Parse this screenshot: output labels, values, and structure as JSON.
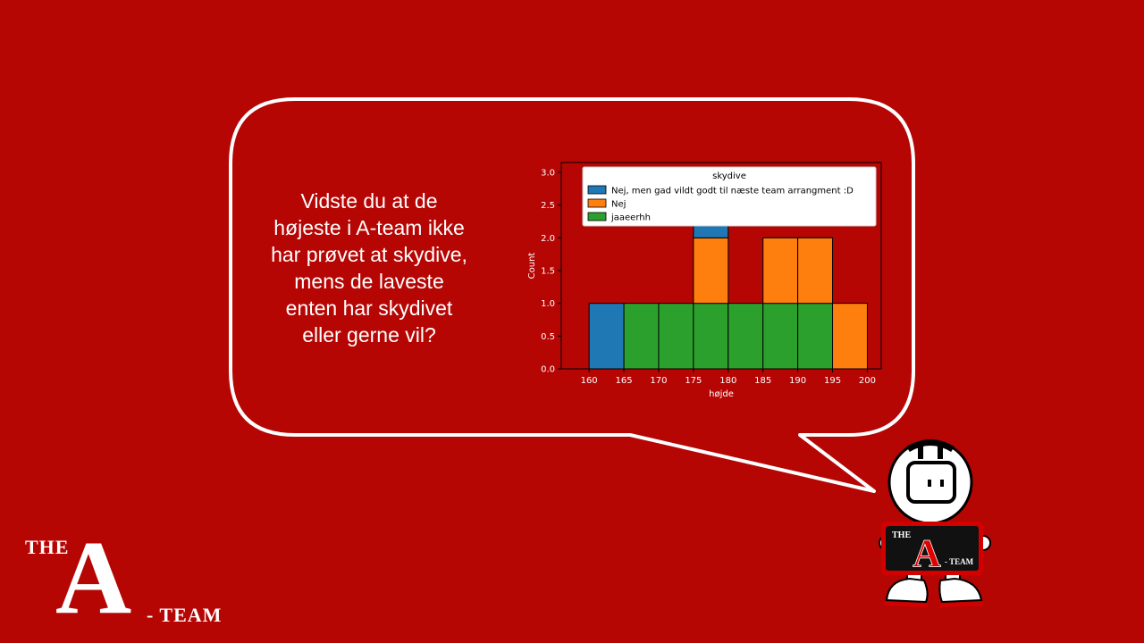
{
  "slide": {
    "question_lines": [
      "Vidste du at de",
      "højeste i A-team ikke",
      "har prøvet at skydive,",
      "mens de laveste",
      "enten har skydivet",
      "eller gerne vil?"
    ]
  },
  "logo": {
    "the": "THE",
    "a": "A",
    "team": "- TEAM"
  },
  "mascot": {
    "sign_the": "THE",
    "sign_a": "A",
    "sign_team": "- TEAM"
  },
  "colors": {
    "background": "#b50604",
    "series_blue": "#1f77b4",
    "series_orange": "#ff7f0e",
    "series_green": "#2ca02c"
  },
  "chart_data": {
    "type": "bar",
    "xlabel": "højde",
    "ylabel": "Count",
    "xlim": [
      156,
      202
    ],
    "ylim": [
      0,
      3.15
    ],
    "x_ticks": [
      160,
      165,
      170,
      175,
      180,
      185,
      190,
      195,
      200
    ],
    "y_ticks": [
      0.0,
      0.5,
      1.0,
      1.5,
      2.0,
      2.5,
      3.0
    ],
    "bin_edges": [
      160,
      165,
      170,
      175,
      180,
      185,
      190,
      195,
      200
    ],
    "stacked": true,
    "legend_title": "skydive",
    "legend_position": "top-right",
    "series": [
      {
        "name": "jaaeerhh",
        "color": "#2ca02c",
        "values": [
          0,
          1,
          1,
          1,
          1,
          1,
          1,
          0
        ]
      },
      {
        "name": "Nej",
        "color": "#ff7f0e",
        "values": [
          0,
          0,
          0,
          1,
          0,
          1,
          1,
          1
        ]
      },
      {
        "name": "Nej, men gad vildt godt til næste team arrangment :D",
        "color": "#1f77b4",
        "values": [
          1,
          0,
          0,
          1,
          0,
          0,
          0,
          0
        ]
      }
    ],
    "legend_order": [
      2,
      1,
      0
    ]
  }
}
